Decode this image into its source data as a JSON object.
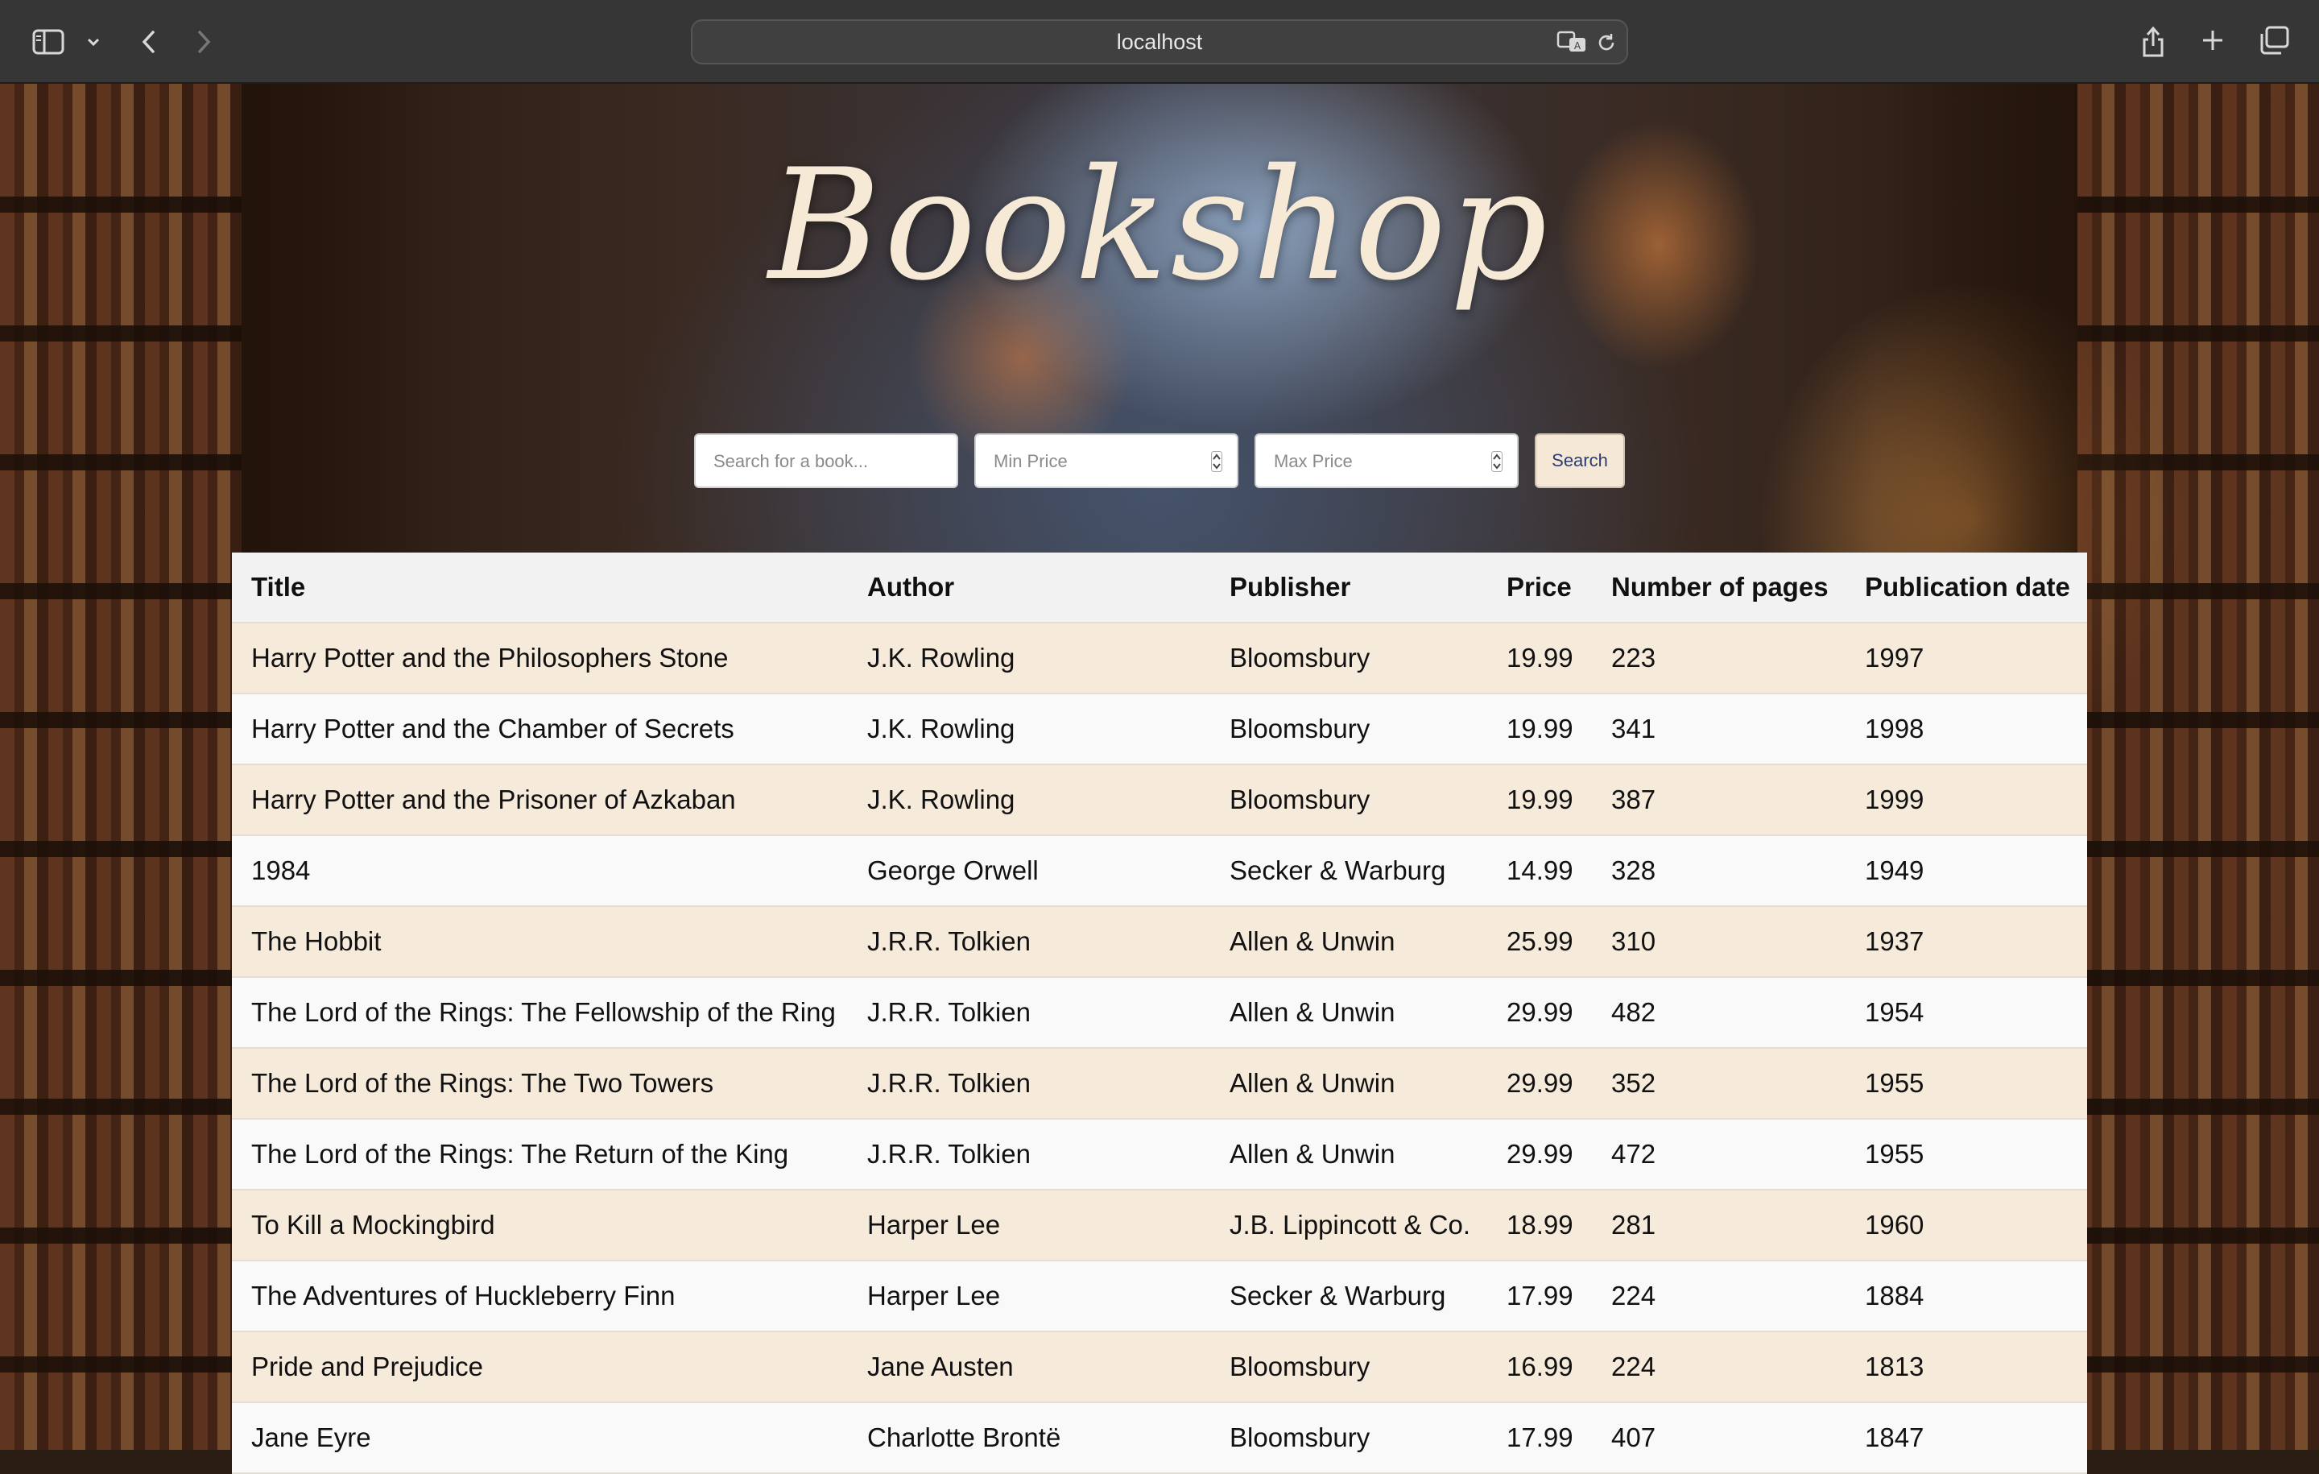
{
  "browser": {
    "address": "localhost",
    "icons": {
      "sidebar": "sidebar-icon",
      "chevron": "chevron-down-icon",
      "back": "back-arrow-icon",
      "forward": "forward-arrow-icon",
      "translate": "translate-icon",
      "reload": "reload-icon",
      "share": "share-icon",
      "new_tab": "plus-icon",
      "tabs": "tab-overview-icon"
    }
  },
  "page": {
    "title": "Bookshop",
    "title_color": "#f6ead6"
  },
  "search": {
    "query_placeholder": "Search for a book...",
    "min_price_placeholder": "Min Price",
    "max_price_placeholder": "Max Price",
    "button_label": "Search",
    "button_bg": "#f6e8d6"
  },
  "table": {
    "row_colors": [
      "#f6eadb",
      "#f9f9f9"
    ],
    "headers": {
      "title": "Title",
      "author": "Author",
      "publisher": "Publisher",
      "price": "Price",
      "pages": "Number of pages",
      "date": "Publication date"
    },
    "rows": [
      {
        "title": "Harry Potter and the Philosophers Stone",
        "author": "J.K. Rowling",
        "publisher": "Bloomsbury",
        "price": "19.99",
        "pages": "223",
        "date": "1997"
      },
      {
        "title": "Harry Potter and the Chamber of Secrets",
        "author": "J.K. Rowling",
        "publisher": "Bloomsbury",
        "price": "19.99",
        "pages": "341",
        "date": "1998"
      },
      {
        "title": "Harry Potter and the Prisoner of Azkaban",
        "author": "J.K. Rowling",
        "publisher": "Bloomsbury",
        "price": "19.99",
        "pages": "387",
        "date": "1999"
      },
      {
        "title": "1984",
        "author": "George Orwell",
        "publisher": "Secker & Warburg",
        "price": "14.99",
        "pages": "328",
        "date": "1949"
      },
      {
        "title": "The Hobbit",
        "author": "J.R.R. Tolkien",
        "publisher": "Allen & Unwin",
        "price": "25.99",
        "pages": "310",
        "date": "1937"
      },
      {
        "title": "The Lord of the Rings: The Fellowship of the Ring",
        "author": "J.R.R. Tolkien",
        "publisher": "Allen & Unwin",
        "price": "29.99",
        "pages": "482",
        "date": "1954"
      },
      {
        "title": "The Lord of the Rings: The Two Towers",
        "author": "J.R.R. Tolkien",
        "publisher": "Allen & Unwin",
        "price": "29.99",
        "pages": "352",
        "date": "1955"
      },
      {
        "title": "The Lord of the Rings: The Return of the King",
        "author": "J.R.R. Tolkien",
        "publisher": "Allen & Unwin",
        "price": "29.99",
        "pages": "472",
        "date": "1955"
      },
      {
        "title": "To Kill a Mockingbird",
        "author": "Harper Lee",
        "publisher": "J.B. Lippincott & Co.",
        "price": "18.99",
        "pages": "281",
        "date": "1960"
      },
      {
        "title": "The Adventures of Huckleberry Finn",
        "author": "Harper Lee",
        "publisher": "Secker & Warburg",
        "price": "17.99",
        "pages": "224",
        "date": "1884"
      },
      {
        "title": "Pride and Prejudice",
        "author": "Jane Austen",
        "publisher": "Bloomsbury",
        "price": "16.99",
        "pages": "224",
        "date": "1813"
      },
      {
        "title": "Jane Eyre",
        "author": "Charlotte Brontë",
        "publisher": "Bloomsbury",
        "price": "17.99",
        "pages": "407",
        "date": "1847"
      }
    ]
  }
}
